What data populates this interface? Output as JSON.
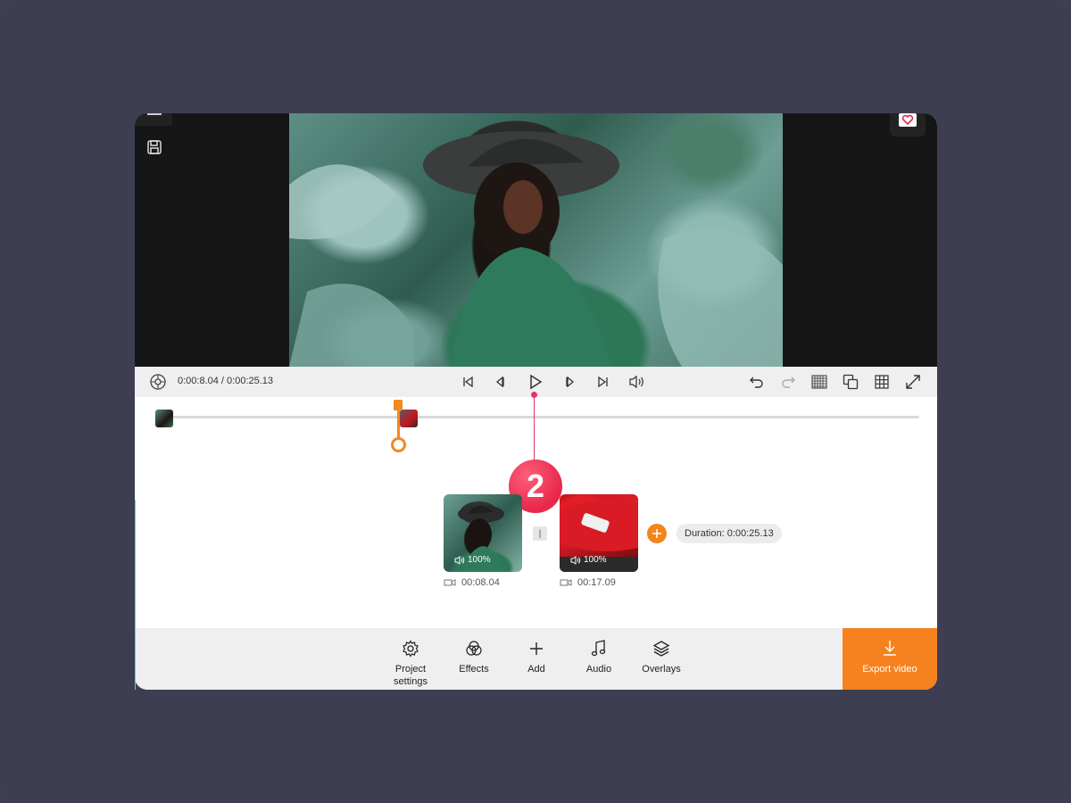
{
  "player": {
    "timecode": "0:00:8.04 / 0:00:25.13"
  },
  "callout": {
    "number": "2"
  },
  "timeline": {
    "playhead_fraction": 0.32
  },
  "clips": [
    {
      "volume": "100%",
      "duration": "00:08.04"
    },
    {
      "volume": "100%",
      "duration": "00:17.09"
    }
  ],
  "project": {
    "duration": "Duration: 0:00:25.13"
  },
  "toolbar": {
    "project_settings": "Project settings",
    "effects": "Effects",
    "add": "Add",
    "audio": "Audio",
    "overlays": "Overlays",
    "export": "Export video"
  },
  "colors": {
    "accent": "#f5821f",
    "callout": "#e8274a",
    "background": "#3e3f52"
  },
  "icons": [
    "menu-icon",
    "save-icon",
    "heart-feedback-icon",
    "settings-wheel-icon",
    "skip-start-icon",
    "step-back-icon",
    "play-icon",
    "step-forward-icon",
    "skip-end-icon",
    "volume-icon",
    "undo-icon",
    "redo-icon",
    "checkerboard-icon",
    "copy-icon",
    "grid-icon",
    "fullscreen-icon",
    "gear-icon",
    "effects-icon",
    "plus-icon",
    "music-note-icon",
    "layers-icon",
    "download-icon",
    "video-camera-icon"
  ]
}
